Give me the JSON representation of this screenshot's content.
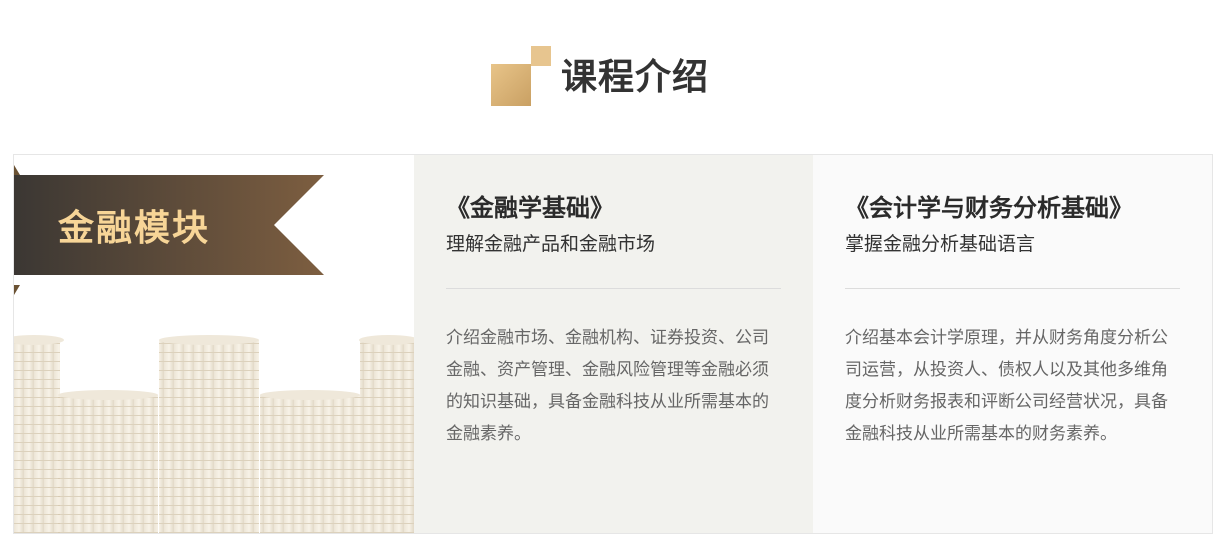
{
  "section": {
    "title": "课程介绍",
    "accent_color": "#d6b06f"
  },
  "module": {
    "label": "金融模块",
    "ribbon_color_start": "#3e3a36",
    "ribbon_color_end": "#7a5c40",
    "label_color": "#f7d597"
  },
  "courses": [
    {
      "title": "《金融学基础》",
      "subtitle": "理解金融产品和金融市场",
      "description": "介绍金融市场、金融机构、证券投资、公司金融、资产管理、金融风险管理等金融必须的知识基础，具备金融科技从业所需基本的金融素养。"
    },
    {
      "title": "《会计学与财务分析基础》",
      "subtitle": "掌握金融分析基础语言",
      "description": "介绍基本会计学原理，并从财务角度分析公司运营，从投资人、债权人以及其他多维角度分析财务报表和评断公司经营状况，具备金融科技从业所需基本的财务素养。"
    }
  ]
}
